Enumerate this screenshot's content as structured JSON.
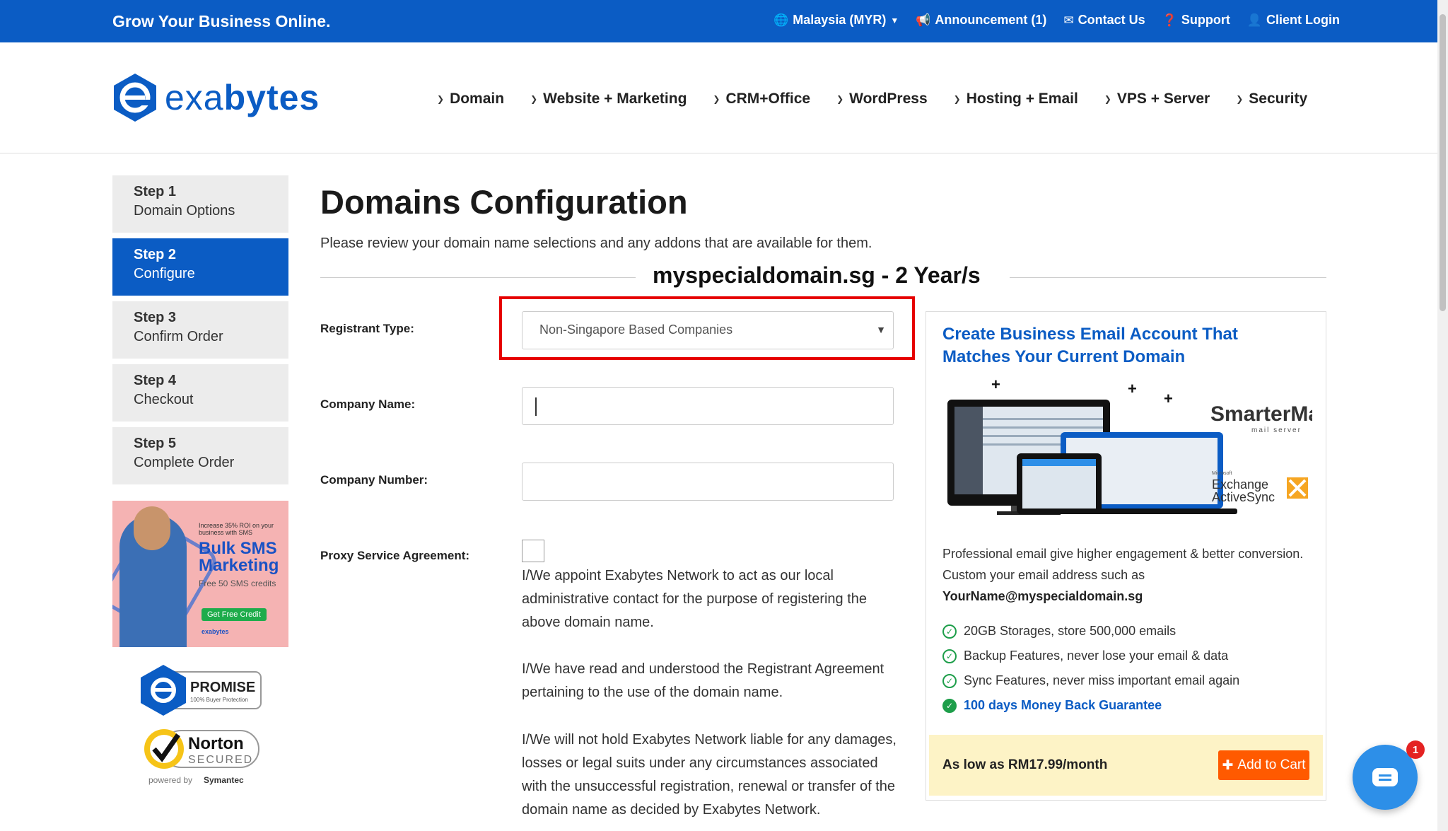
{
  "topbar": {
    "tagline": "Grow Your Business Online.",
    "items": [
      {
        "icon": "globe-icon",
        "label": "Malaysia (MYR)",
        "chevron": true
      },
      {
        "icon": "megaphone-icon",
        "label": "Announcement (1)"
      },
      {
        "icon": "envelope-icon",
        "label": "Contact Us"
      },
      {
        "icon": "question-icon",
        "label": "Support"
      },
      {
        "icon": "user-icon",
        "label": "Client Login"
      }
    ]
  },
  "logo": {
    "prefix": "exa",
    "suffix": "bytes"
  },
  "nav": [
    "Domain",
    "Website + Marketing",
    "CRM+Office",
    "WordPress",
    "Hosting + Email",
    "VPS + Server",
    "Security"
  ],
  "steps": [
    {
      "num": "Step 1",
      "label": "Domain Options",
      "active": false
    },
    {
      "num": "Step 2",
      "label": "Configure",
      "active": true
    },
    {
      "num": "Step 3",
      "label": "Confirm Order",
      "active": false
    },
    {
      "num": "Step 4",
      "label": "Checkout",
      "active": false
    },
    {
      "num": "Step 5",
      "label": "Complete Order",
      "active": false
    }
  ],
  "promo": {
    "small": "Increase 35% ROI on your business with SMS",
    "big1": "Bulk SMS",
    "big2": "Marketing",
    "credits": "Free 50 SMS credits",
    "button": "Get Free Credit",
    "brand": "exabytes"
  },
  "badges": {
    "promise_title": "PROMISE",
    "promise_sub": "100% Buyer Protection",
    "norton_title": "Norton",
    "norton_sub": "SECURED",
    "norton_by": "powered by",
    "norton_vendor": "Symantec"
  },
  "main": {
    "title": "Domains Configuration",
    "subtitle": "Please review your domain name selections and any addons that are available for them.",
    "domain_heading": "myspecialdomain.sg - 2 Year/s",
    "labels": {
      "registrant": "Registrant Type:",
      "company_name": "Company Name:",
      "company_number": "Company Number:",
      "proxy": "Proxy Service Agreement:"
    },
    "registrant_value": "Non-Singapore Based Companies",
    "company_name_value": "",
    "company_number_value": "",
    "paragraphs": [
      "I/We appoint Exabytes Network to act as our local administrative contact for the purpose of registering the above domain name.",
      "I/We have read and understood the Registrant Agreement pertaining to the use of the domain name.",
      "I/We will not hold Exabytes Network liable for any damages, losses or legal suits under any circumstances associated with the unsuccessful registration, renewal or transfer of the domain name as decided by Exabytes Network."
    ]
  },
  "card": {
    "heading": "Create Business Email Account That Matches Your Current Domain",
    "brand1": "SmarterMail",
    "brand1_sub": "mail server",
    "brand2_small": "Microsoft",
    "brand2a": "Exchange",
    "brand2b": "ActiveSync",
    "desc": "Professional email give higher engagement & better conversion. Custom your email address such as",
    "example": "YourName@myspecialdomain.sg",
    "features": [
      "20GB Storages, store 500,000 emails",
      "Backup Features, never lose your email & data",
      "Sync Features, never miss important email again",
      "100 days Money Back Guarantee"
    ],
    "price": "As low as RM17.99/month",
    "cart": "Add to Cart"
  },
  "chat": {
    "count": "1"
  },
  "colors": {
    "brand": "#0b5cc4",
    "cta": "#ff5a00",
    "highlight": "#e60000",
    "check": "#1e9e4a"
  }
}
